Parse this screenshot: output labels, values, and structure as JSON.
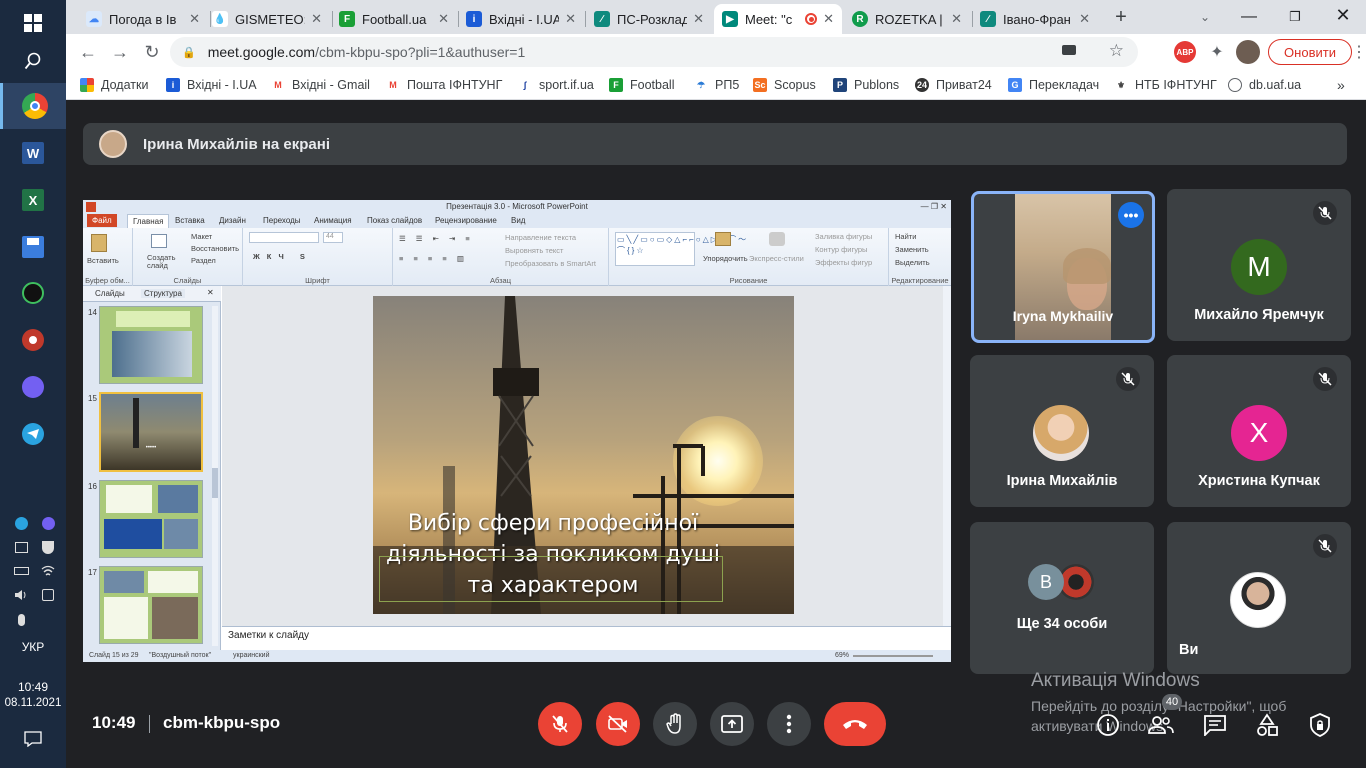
{
  "browser": {
    "tabs": [
      {
        "title": "Погода в Ів",
        "icon": "weather-favicon",
        "color": "#4285f4"
      },
      {
        "title": "GISMETEO: ",
        "icon": "gismeteo-favicon",
        "color": "#1e88e5"
      },
      {
        "title": "Football.ua",
        "icon": "football-favicon",
        "color": "#1a9f36"
      },
      {
        "title": "Вхідні - I.UA",
        "icon": "iua-favicon",
        "color": "#1b5bd6"
      },
      {
        "title": "ПС-Розклад",
        "icon": "ps-favicon",
        "color": "#0f8a7e"
      },
      {
        "title": "Meet: \"c",
        "icon": "meet-favicon",
        "color": "#00897b"
      },
      {
        "title": "ROZETKA | ",
        "icon": "rozetka-favicon",
        "color": "#109c4c"
      },
      {
        "title": "Івано-Фран",
        "icon": "ivano-favicon",
        "color": "#0f8a7e"
      }
    ],
    "url_host": "meet.google.com",
    "url_path": "/cbm-kbpu-spo?pli=1&authuser=1",
    "update_button": "Оновити",
    "abp_badge": "ABP",
    "bookmarks": [
      {
        "label": "Додатки",
        "icon": "apps-icon",
        "color": "#ea4335"
      },
      {
        "label": "Вхідні - I.UA",
        "icon": "iua-icon",
        "color": "#1b5bd6"
      },
      {
        "label": "Вхідні - Gmail",
        "icon": "gmail-icon",
        "color": "#ea4335"
      },
      {
        "label": "Пошта ІФНТУНГ",
        "icon": "gmail-icon",
        "color": "#ea4335"
      },
      {
        "label": "sport.if.ua",
        "icon": "sport-icon",
        "color": "#1b3fa0"
      },
      {
        "label": "Football",
        "icon": "football-icon",
        "color": "#1a9f36"
      },
      {
        "label": "РП5",
        "icon": "rp5-icon",
        "color": "#2b7bd6"
      },
      {
        "label": "Scopus",
        "icon": "scopus-icon",
        "color": "#f36f21"
      },
      {
        "label": "Publons",
        "icon": "publons-icon",
        "color": "#20447a"
      },
      {
        "label": "Приват24",
        "icon": "privat-icon",
        "color": "#333333"
      },
      {
        "label": "Перекладач",
        "icon": "translate-icon",
        "color": "#4285f4"
      },
      {
        "label": "НТБ ІФНТУНГ",
        "icon": "ntb-icon",
        "color": "#444444"
      },
      {
        "label": "db.uaf.ua",
        "icon": "globe-icon",
        "color": "#5f6368"
      }
    ]
  },
  "taskbar": {
    "lang": "УКР",
    "time": "10:49",
    "date": "08.11.2021"
  },
  "meet": {
    "presenter_banner": "Ірина Михайлів на екрані",
    "tiles": [
      {
        "name": "Iryna Mykhailiv",
        "kind": "video"
      },
      {
        "name": "Михайло Яремчук",
        "initial": "M",
        "color": "#33691e"
      },
      {
        "name": "Ірина Михайлів",
        "kind": "photo"
      },
      {
        "name": "Христина Купчак",
        "initial": "Х",
        "color": "#e52592"
      },
      {
        "name": "Ще 34 особи",
        "initial": "B",
        "color": "#78909c"
      },
      {
        "name": "Ви",
        "kind": "photo"
      }
    ],
    "time": "10:49",
    "meeting_code": "cbm-kbpu-spo",
    "people_badge": "40",
    "activation_title": "Активація Windows",
    "activation_text": "Перейдіть до розділу \"Настройки\", щоб активувати Windows."
  },
  "ppt": {
    "window_title": "Презентація 3.0 - Microsoft PowerPoint",
    "tabs": [
      "Файл",
      "Главная",
      "Вставка",
      "Дизайн",
      "Переходы",
      "Анимация",
      "Показ слайдов",
      "Рецензирование",
      "Вид"
    ],
    "group_labels": [
      "Буфер обм...",
      "Слайды",
      "Шрифт",
      "Абзац",
      "Рисование",
      "Редактирование"
    ],
    "ribbon_text": {
      "paste": "Вставить",
      "create_slide": "Создать слайд",
      "layout": "Макет",
      "restore": "Восстановить",
      "section": "Раздел",
      "text_dir": "Направление текста",
      "align_text": "Выровнять текст",
      "smartart": "Преобразовать в SmartArt",
      "arrange": "Упорядочить",
      "quick_styles": "Экспресс-стили",
      "fill": "Заливка фигуры",
      "outline": "Контур фигуры",
      "effects": "Эффекты фигур",
      "find": "Найти",
      "replace": "Заменить",
      "select": "Выделить",
      "font_size": "44"
    },
    "left_tabs": [
      "Слайды",
      "Структура"
    ],
    "slide_numbers": [
      "14",
      "15",
      "16",
      "17"
    ],
    "slide_title": "Вибір сфери професійної діяльності за покликом душі та характером",
    "notes_placeholder": "Заметки к слайду",
    "status": {
      "slide_count": "Слайд 15 из 29",
      "theme": "\"Воздушный поток\"",
      "lang": "украинский",
      "zoom": "69%"
    }
  }
}
